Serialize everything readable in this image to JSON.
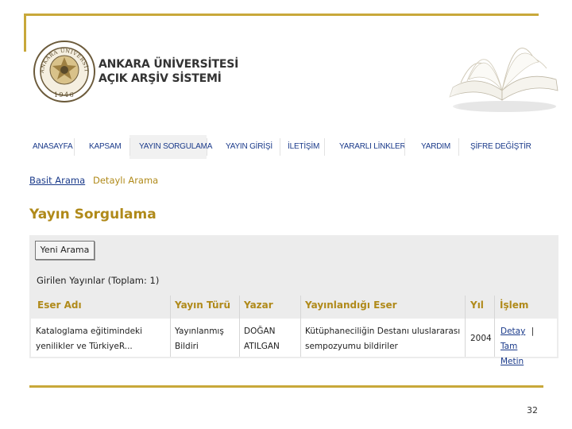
{
  "header": {
    "brand_line1": "ANKARA ÜNİVERSİTESİ",
    "brand_line2": "AÇIK ARŞİV SİSTEMİ",
    "logo_year": "1946",
    "logo_ring_text": "ANKARA ÜNİVERSİTESİ"
  },
  "nav": {
    "items": [
      "ANASAYFA",
      "KAPSAM",
      "YAYIN SORGULAMA",
      "YAYIN GİRİŞİ",
      "İLETİŞİM",
      "YARARLI LİNKLER",
      "YARDIM",
      "ŞİFRE DEĞİŞTİR"
    ],
    "active": "YAYIN SORGULAMA"
  },
  "search_tabs": {
    "basit": "Basit Arama",
    "detayli": "Detaylı Arama"
  },
  "page_title": "Yayın Sorgulama",
  "new_search_button": "Yeni Arama",
  "results_count_text": "Girilen Yayınlar (Toplam: 1)",
  "table": {
    "headers": [
      "Eser Adı",
      "Yayın Türü",
      "Yazar",
      "Yayınlandığı Eser",
      "Yıl",
      "İşlem"
    ],
    "rows": [
      {
        "eser_adi": [
          "Kataloglama eğitimindeki",
          "yenilikler ve TürkiyeR..."
        ],
        "yayin_turu": [
          "Yayınlanmış",
          "Bildiri"
        ],
        "yazar": [
          "DOĞAN",
          "ATILGAN"
        ],
        "yayinlandigi_eser": [
          "Kütüphaneciliğin Destanı uluslararası",
          "sempozyumu bildiriler"
        ],
        "yil": "2004",
        "islem": {
          "detay": "Detay",
          "separator": "|",
          "tam_metin_1": "Tam",
          "tam_metin_2": "Metin"
        }
      }
    ]
  },
  "slide_number": "32",
  "colors": {
    "gold": "#c8a83a",
    "title_gold": "#b08a1a",
    "nav_blue": "#1a3a8a",
    "panel_gray": "#ececec"
  }
}
